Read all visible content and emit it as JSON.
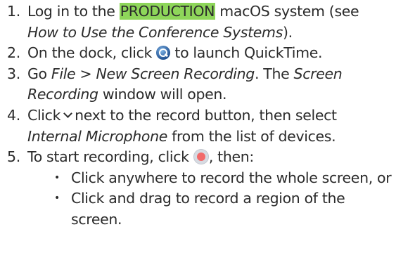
{
  "steps": [
    {
      "num": "1.",
      "pre": "Log in to the ",
      "highlight": "PRODUCTION",
      "mid": " macOS system (see ",
      "em": "How to Use the Conference Systems",
      "post": ")."
    },
    {
      "num": "2.",
      "pre": "On the dock, click ",
      "icon": "quicktime-icon",
      "post": " to launch QuickTime."
    },
    {
      "num": "3.",
      "pre": "Go ",
      "em1": "File > New Screen Recording",
      "mid": ". The ",
      "em2": "Screen Recording",
      "post": " window will open."
    },
    {
      "num": "4.",
      "pre": "Click",
      "icon": "chevron-down-icon",
      "mid": "next to the record button, then select ",
      "em": "Internal Microphone",
      "post": " from the list of devices."
    },
    {
      "num": "5.",
      "pre": "To start recording, click ",
      "icon": "record-button-icon",
      "post": ", then:",
      "bullets": [
        "Click anywhere to record the whole screen, or",
        "Click and drag to record a region of the screen."
      ]
    }
  ],
  "colors": {
    "highlight": "#8ed65a",
    "text": "#2b2b2b",
    "record_dot": "#f26a6a"
  }
}
